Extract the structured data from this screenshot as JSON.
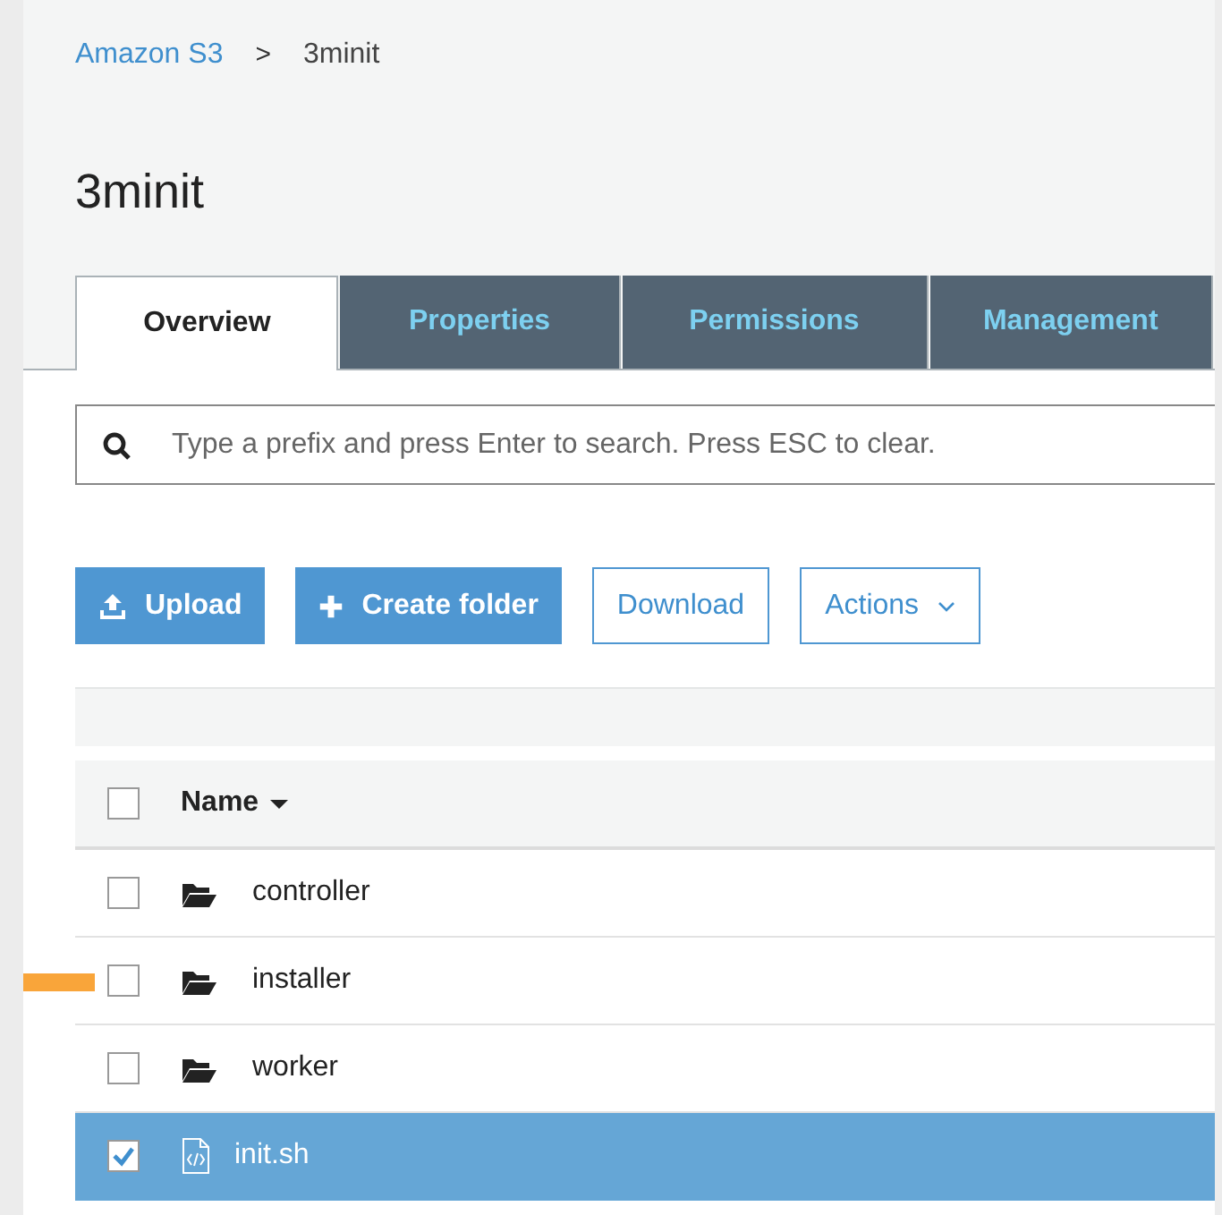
{
  "breadcrumb": {
    "link": "Amazon S3",
    "separator": ">",
    "current": "3minit"
  },
  "title": "3minit",
  "tabs": [
    {
      "label": "Overview",
      "selected": true
    },
    {
      "label": "Properties",
      "selected": false
    },
    {
      "label": "Permissions",
      "selected": false
    },
    {
      "label": "Management",
      "selected": false
    }
  ],
  "search": {
    "placeholder": "Type a prefix and press Enter to search. Press ESC to clear."
  },
  "buttons": [
    {
      "label": "Upload",
      "kind": "upload"
    },
    {
      "label": "Create folder",
      "kind": "add"
    },
    {
      "label": "Download",
      "kind": "outline"
    },
    {
      "label": "Actions",
      "kind": "dropdown"
    }
  ],
  "table": {
    "header": {
      "label": "Name",
      "checked": false
    },
    "rows": [
      {
        "name": "controller",
        "kind": "folder",
        "checked": false,
        "selected": false,
        "marked": false
      },
      {
        "name": "installer",
        "kind": "folder",
        "checked": false,
        "selected": false,
        "marked": true
      },
      {
        "name": "worker",
        "kind": "folder",
        "checked": false,
        "selected": false,
        "marked": false
      },
      {
        "name": "init.sh",
        "kind": "file",
        "checked": true,
        "selected": true,
        "marked": false
      }
    ]
  }
}
